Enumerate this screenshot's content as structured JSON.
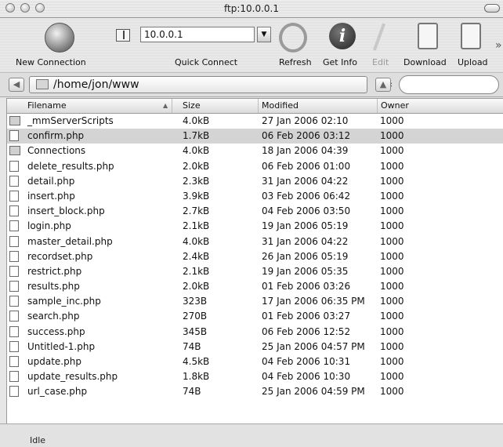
{
  "window": {
    "title": "ftp:10.0.0.1"
  },
  "toolbar": {
    "new_connection": "New Connection",
    "quick_connect": "Quick Connect",
    "host_value": "10.0.0.1",
    "refresh": "Refresh",
    "get_info": "Get Info",
    "edit": "Edit",
    "download": "Download",
    "upload": "Upload",
    "info_glyph": "i",
    "more_glyph": "»"
  },
  "path": {
    "current": "/home/jon/www"
  },
  "table": {
    "headers": {
      "filename": "Filename",
      "size": "Size",
      "modified": "Modified",
      "owner": "Owner"
    },
    "sort_indicator": "▲",
    "rows": [
      {
        "type": "folder",
        "name": "_mmServerScripts",
        "size": "4.0kB",
        "modified": "27 Jan 2006 02:10",
        "owner": "1000"
      },
      {
        "type": "file",
        "name": "confirm.php",
        "size": "1.7kB",
        "modified": "06 Feb 2006 03:12",
        "owner": "1000",
        "selected": true
      },
      {
        "type": "folder",
        "name": "Connections",
        "size": "4.0kB",
        "modified": "18 Jan 2006 04:39",
        "owner": "1000"
      },
      {
        "type": "file",
        "name": "delete_results.php",
        "size": "2.0kB",
        "modified": "06 Feb 2006 01:00",
        "owner": "1000"
      },
      {
        "type": "file",
        "name": "detail.php",
        "size": "2.3kB",
        "modified": "31 Jan 2006 04:22",
        "owner": "1000"
      },
      {
        "type": "file",
        "name": "insert.php",
        "size": "3.9kB",
        "modified": "03 Feb 2006 06:42",
        "owner": "1000"
      },
      {
        "type": "file",
        "name": "insert_block.php",
        "size": "2.7kB",
        "modified": "04 Feb 2006 03:50",
        "owner": "1000"
      },
      {
        "type": "file",
        "name": "login.php",
        "size": "2.1kB",
        "modified": "19 Jan 2006 05:19",
        "owner": "1000"
      },
      {
        "type": "file",
        "name": "master_detail.php",
        "size": "4.0kB",
        "modified": "31 Jan 2006 04:22",
        "owner": "1000"
      },
      {
        "type": "file",
        "name": "recordset.php",
        "size": "2.4kB",
        "modified": "26 Jan 2006 05:19",
        "owner": "1000"
      },
      {
        "type": "file",
        "name": "restrict.php",
        "size": "2.1kB",
        "modified": "19 Jan 2006 05:35",
        "owner": "1000"
      },
      {
        "type": "file",
        "name": "results.php",
        "size": "2.0kB",
        "modified": "01 Feb 2006 03:26",
        "owner": "1000"
      },
      {
        "type": "file",
        "name": "sample_inc.php",
        "size": "323B",
        "modified": "17 Jan 2006 06:35  PM",
        "owner": "1000"
      },
      {
        "type": "file",
        "name": "search.php",
        "size": "270B",
        "modified": "01 Feb 2006 03:27",
        "owner": "1000"
      },
      {
        "type": "file",
        "name": "success.php",
        "size": "345B",
        "modified": "06 Feb 2006 12:52",
        "owner": "1000"
      },
      {
        "type": "file",
        "name": "Untitled-1.php",
        "size": "74B",
        "modified": "25 Jan 2006 04:57  PM",
        "owner": "1000"
      },
      {
        "type": "file",
        "name": "update.php",
        "size": "4.5kB",
        "modified": "04 Feb 2006 10:31",
        "owner": "1000"
      },
      {
        "type": "file",
        "name": "update_results.php",
        "size": "1.8kB",
        "modified": "04 Feb 2006 10:30",
        "owner": "1000"
      },
      {
        "type": "file",
        "name": "url_case.php",
        "size": "74B",
        "modified": "25 Jan 2006 04:59  PM",
        "owner": "1000"
      }
    ]
  },
  "status": {
    "text": "Idle"
  }
}
